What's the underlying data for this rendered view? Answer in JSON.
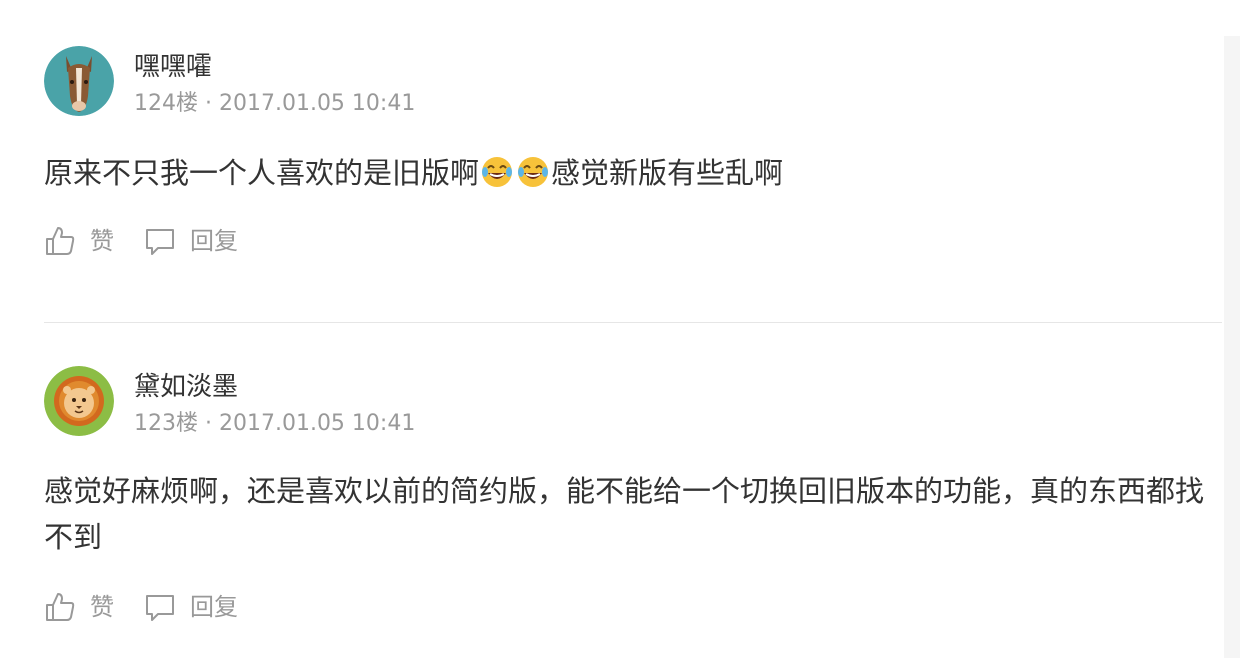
{
  "comments": [
    {
      "username": "嘿嘿嚯",
      "meta": "124楼 · 2017.01.05 10:41",
      "text_before": "原来不只我一个人喜欢的是旧版啊",
      "text_after": "感觉新版有些乱啊",
      "emojis": [
        "tears-of-joy-emoji",
        "tears-of-joy-emoji"
      ],
      "like_label": "赞",
      "reply_label": "回复"
    },
    {
      "username": "黛如淡墨",
      "meta": "123楼 · 2017.01.05 10:41",
      "text": "感觉好麻烦啊，还是喜欢以前的简约版，能不能给一个切换回旧版本的功能，真的东西都找不到",
      "like_label": "赞",
      "reply_label": "回复"
    }
  ],
  "icons": {
    "like": "thumbs-up-icon",
    "reply": "speech-bubble-icon"
  },
  "colors": {
    "text": "#333333",
    "muted": "#999999",
    "divider": "#e6e6e6",
    "avatar_1_bg": "#4aa3a8",
    "avatar_2_bg": "#8cbd45"
  }
}
